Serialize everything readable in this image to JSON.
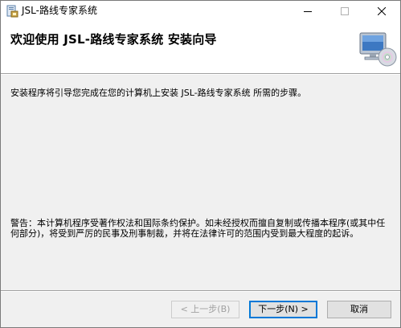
{
  "window": {
    "title": "JSL-路线专家系统",
    "controls": {
      "minimize_icon": "minimize-icon",
      "maximize_icon": "maximize-icon",
      "close_icon": "close-icon"
    }
  },
  "header": {
    "title": "欢迎使用 JSL-路线专家系统 安装向导",
    "graphic_icon": "computer-cd-icon"
  },
  "body": {
    "intro": "安装程序将引导您完成在您的计算机上安装 JSL-路线专家系统 所需的步骤。",
    "warning": "警告：本计算机程序受著作权法和国际条约保护。如未经授权而擅自复制或传播本程序(或其中任何部分)，将受到严厉的民事及刑事制裁，并将在法律许可的范围内受到最大程度的起诉。"
  },
  "buttons": {
    "back": "< 上一步(B)",
    "next": "下一步(N) >",
    "cancel": "取消"
  },
  "colors": {
    "accent": "#0078d7",
    "face": "#f0f0f0",
    "header_bg": "#ffffff"
  }
}
